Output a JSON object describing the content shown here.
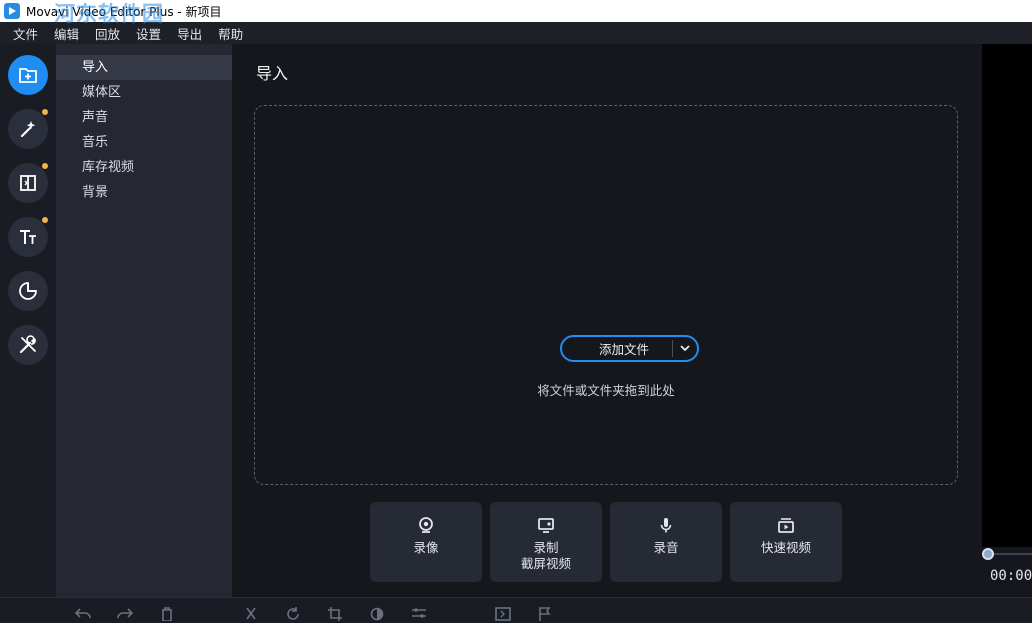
{
  "window": {
    "title": "Movavi Video Editor Plus - 新项目"
  },
  "watermark": {
    "line1": "河东软件园",
    "line2": "www.pc0359.cn"
  },
  "menu": {
    "items": [
      "文件",
      "编辑",
      "回放",
      "设置",
      "导出",
      "帮助"
    ]
  },
  "sidebar": {
    "buttons": [
      {
        "icon": "import-icon",
        "active": true,
        "badge": false
      },
      {
        "icon": "magic-wand-icon",
        "active": false,
        "badge": true
      },
      {
        "icon": "transitions-icon",
        "active": false,
        "badge": true
      },
      {
        "icon": "titles-icon",
        "active": false,
        "badge": true
      },
      {
        "icon": "stickers-icon",
        "active": false,
        "badge": false
      },
      {
        "icon": "tools-icon",
        "active": false,
        "badge": false
      }
    ]
  },
  "subnav": {
    "items": [
      "导入",
      "媒体区",
      "声音",
      "音乐",
      "库存视频",
      "背景"
    ],
    "active_index": 0
  },
  "main": {
    "title": "导入",
    "add_button_label": "添加文件",
    "drop_hint": "将文件或文件夹拖到此处",
    "quick_actions": [
      {
        "icon": "webcam-icon",
        "label_lines": [
          "录像"
        ]
      },
      {
        "icon": "screen-record-icon",
        "label_lines": [
          "录制",
          "截屏视频"
        ]
      },
      {
        "icon": "microphone-icon",
        "label_lines": [
          "录音"
        ]
      },
      {
        "icon": "quick-video-icon",
        "label_lines": [
          "快速视频"
        ]
      }
    ]
  },
  "preview": {
    "timecode": "00:00"
  },
  "colors": {
    "accent": "#1f8df2",
    "badge": "#f0b64b",
    "panel": "#252833",
    "background": "#15171d"
  }
}
